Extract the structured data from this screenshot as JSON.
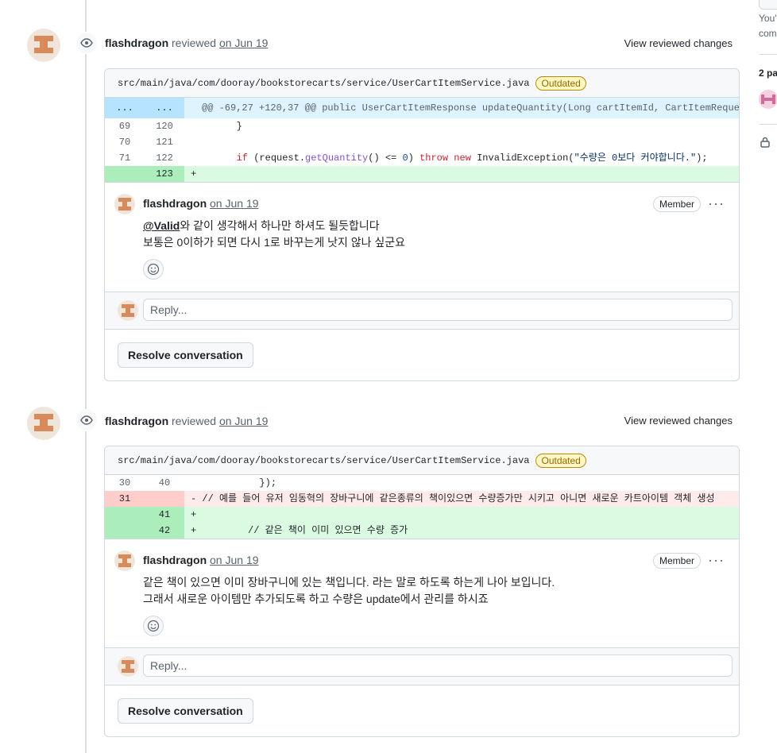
{
  "colors": {
    "accent_avatar": "#d98a5b",
    "added_bg": "#dafbe1",
    "removed_bg": "#ffebe9",
    "hunk_bg": "#ddf4ff"
  },
  "sidebar": {
    "frag_1": "You'",
    "frag_2": "com",
    "participants": "2 pa",
    "lock_icon": "lock-icon"
  },
  "reviews": [
    {
      "author": "flashdragon",
      "action": "reviewed",
      "date": "on Jun 19",
      "view_changes": "View reviewed changes",
      "file": "src/main/java/com/dooray/bookstorecarts/service/UserCartItemService.java",
      "badge": "Outdated",
      "diff": {
        "hunk": {
          "old": "...",
          "new": "...",
          "text": "@@ -69,27 +120,37 @@ public UserCartItemResponse updateQuantity(Long cartItemId, CartItemReque"
        },
        "lines": [
          {
            "old": "69",
            "new": "120",
            "type": "context",
            "code": "        }"
          },
          {
            "old": "70",
            "new": "121",
            "type": "context",
            "code": ""
          },
          {
            "old": "71",
            "new": "122",
            "type": "context",
            "code": "        if (request.getQuantity() <= 0) throw new InvalidException(\"수량은 0보다 커야합니다.\");"
          },
          {
            "old": "",
            "new": "123",
            "type": "add",
            "code": "+"
          }
        ]
      },
      "comment": {
        "author": "flashdragon",
        "date": "on Jun 19",
        "role": "Member",
        "mention": "@Valid",
        "line1_rest": "와 같이 생각해서 하나만 하셔도 될듯합니다",
        "line2": "보통은 0이하가 되면 다시 1로 바꾸는게 낫지 않나 싶군요"
      },
      "reply_placeholder": "Reply...",
      "resolve_label": "Resolve conversation"
    },
    {
      "author": "flashdragon",
      "action": "reviewed",
      "date": "on Jun 19",
      "view_changes": "View reviewed changes",
      "file": "src/main/java/com/dooray/bookstorecarts/service/UserCartItemService.java",
      "badge": "Outdated",
      "diff": {
        "lines": [
          {
            "old": "30",
            "new": "40",
            "type": "context",
            "code": "            });"
          },
          {
            "old": "31",
            "new": "",
            "type": "del",
            "code": "- // 예를 들어 유저 임동혁의 장바구니에 같은종류의 책이있으면 수량증가만 시키고 아니면 새로운 카트아이템 객체 생성"
          },
          {
            "old": "",
            "new": "41",
            "type": "add",
            "code": "+"
          },
          {
            "old": "",
            "new": "42",
            "type": "add",
            "code": "+         // 같은 책이 이미 있으면 수량 증가"
          }
        ]
      },
      "comment": {
        "author": "flashdragon",
        "date": "on Jun 19",
        "role": "Member",
        "line1": "같은 책이 있으면 이미 장바구니에 있는 책입니다. 라는 말로 하도록 하는게 나아 보입니다.",
        "line2": "그래서 새로운 아이템만 추가되도록 하고 수량은 update에서 관리를 하시죠"
      },
      "reply_placeholder": "Reply...",
      "resolve_label": "Resolve conversation"
    }
  ]
}
